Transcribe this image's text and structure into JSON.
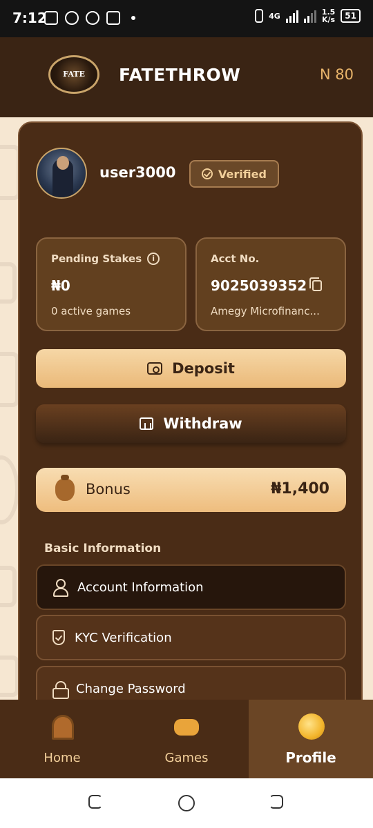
{
  "status_bar": {
    "time": "7:12",
    "network": "4G",
    "speed_value": "1.5",
    "speed_unit": "K/s",
    "battery": "51"
  },
  "header": {
    "logo_text": "FATE",
    "brand": "FATETHROW",
    "balance": "N 80"
  },
  "profile": {
    "username": "user3000",
    "verified_label": "Verified"
  },
  "stats": {
    "pending": {
      "label": "Pending Stakes",
      "value": "₦0",
      "sub": "0 active games"
    },
    "account": {
      "label": "Acct No.",
      "value": "9025039352",
      "sub": "Amegy Microfinanc..."
    }
  },
  "actions": {
    "deposit": "Deposit",
    "withdraw": "Withdraw"
  },
  "bonus": {
    "label": "Bonus",
    "amount": "₦1,400"
  },
  "basic_info": {
    "title": "Basic Information",
    "items": [
      {
        "label": "Account Information",
        "icon": "person-icon"
      },
      {
        "label": "KYC Verification",
        "icon": "shield-icon"
      },
      {
        "label": "Change Password",
        "icon": "lock-icon"
      }
    ]
  },
  "bottom_nav": {
    "items": [
      {
        "label": "Home",
        "icon": "door-icon"
      },
      {
        "label": "Games",
        "icon": "gamepad-icon"
      },
      {
        "label": "Profile",
        "icon": "coin-icon"
      }
    ],
    "active": "Profile"
  },
  "colors": {
    "header_bg": "#3a2414",
    "card_bg": "#4a2c16",
    "accent_gold": "#eab979",
    "page_bg": "#f6e7d2"
  }
}
